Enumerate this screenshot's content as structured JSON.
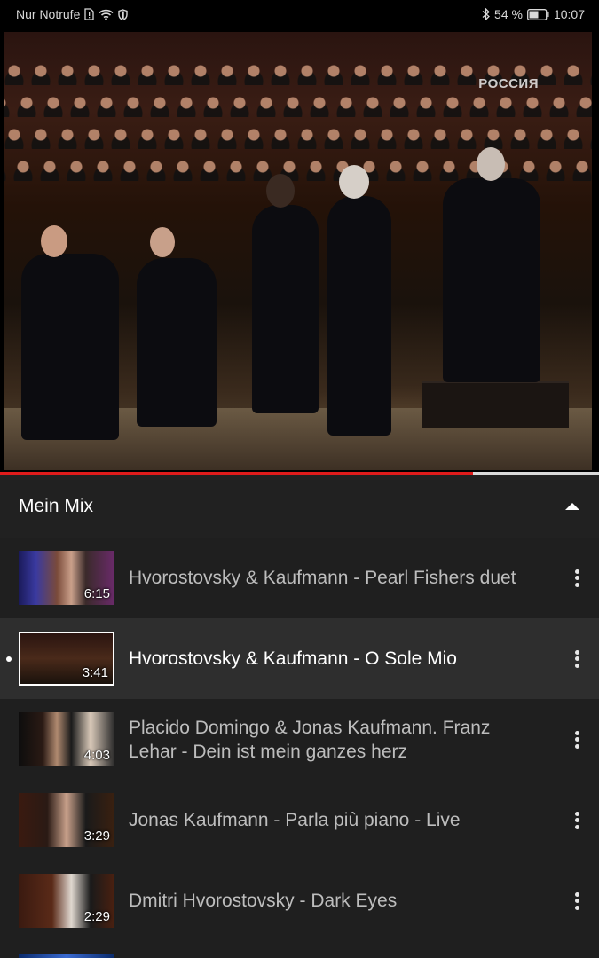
{
  "status_bar": {
    "carrier": "Nur Notrufe",
    "battery": "54 %",
    "time": "10:07",
    "icons": [
      "sim-alert-icon",
      "wifi-icon",
      "shield-icon",
      "bluetooth-icon",
      "battery-icon"
    ]
  },
  "video": {
    "watermark": "РОССИЯ",
    "progress": 0.79
  },
  "playlist": {
    "title": "Mein Mix",
    "items": [
      {
        "title": "Hvorostovsky & Kaufmann - Pearl Fishers duet",
        "duration": "6:15",
        "active": false
      },
      {
        "title": "Hvorostovsky & Kaufmann - O Sole Mio",
        "duration": "3:41",
        "active": true
      },
      {
        "title": "Placido Domingo & Jonas Kaufmann. Franz Lehar - Dein ist mein ganzes herz",
        "duration": "4:03",
        "active": false
      },
      {
        "title": "Jonas Kaufmann - Parla più piano - Live",
        "duration": "3:29",
        "active": false
      },
      {
        "title": "Dmitri Hvorostovsky - Dark Eyes",
        "duration": "2:29",
        "active": false
      }
    ]
  },
  "colors": {
    "progress_red": "#e01b1b",
    "background": "#1f1f1f",
    "active_row": "#2e2e2e"
  }
}
